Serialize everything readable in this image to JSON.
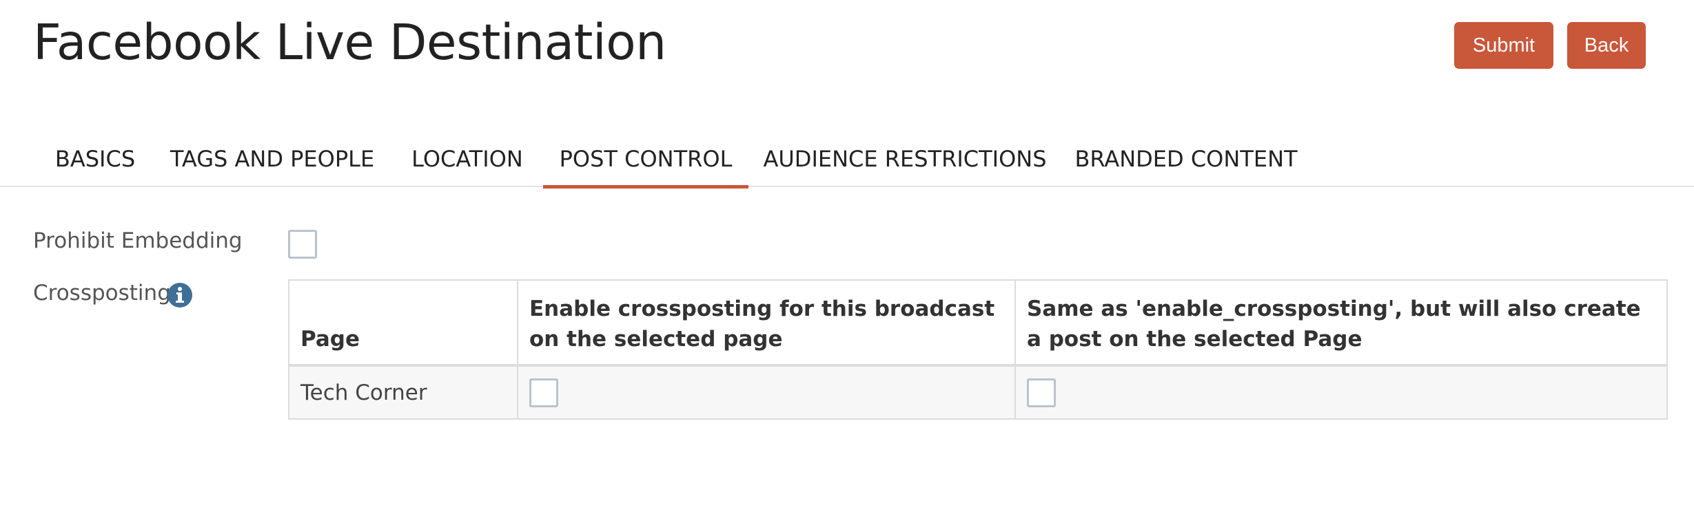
{
  "header": {
    "title": "Facebook Live Destination",
    "submit_label": "Submit",
    "back_label": "Back"
  },
  "tabs": [
    {
      "label": "BASICS",
      "active": false
    },
    {
      "label": "TAGS AND PEOPLE",
      "active": false
    },
    {
      "label": "LOCATION",
      "active": false
    },
    {
      "label": "POST CONTROL",
      "active": true
    },
    {
      "label": "AUDIENCE RESTRICTIONS",
      "active": false
    },
    {
      "label": "BRANDED CONTENT",
      "active": false
    }
  ],
  "form": {
    "prohibit_embedding_label": "Prohibit Embedding",
    "prohibit_embedding_checked": false,
    "crossposting_label": "Crossposting"
  },
  "crossposting_table": {
    "columns": [
      "Page",
      "Enable crossposting for this broadcast on the selected page",
      "Same as 'enable_crossposting', but will also create a post on the selected Page"
    ],
    "rows": [
      {
        "page": "Tech Corner",
        "enable_crossposting": false,
        "create_post": false
      }
    ]
  },
  "colors": {
    "accent": "#c9573a",
    "checkbox_border": "#b9c3cc",
    "info_icon": "#3f6f96"
  },
  "icons": {
    "info": "info-circle-icon"
  }
}
